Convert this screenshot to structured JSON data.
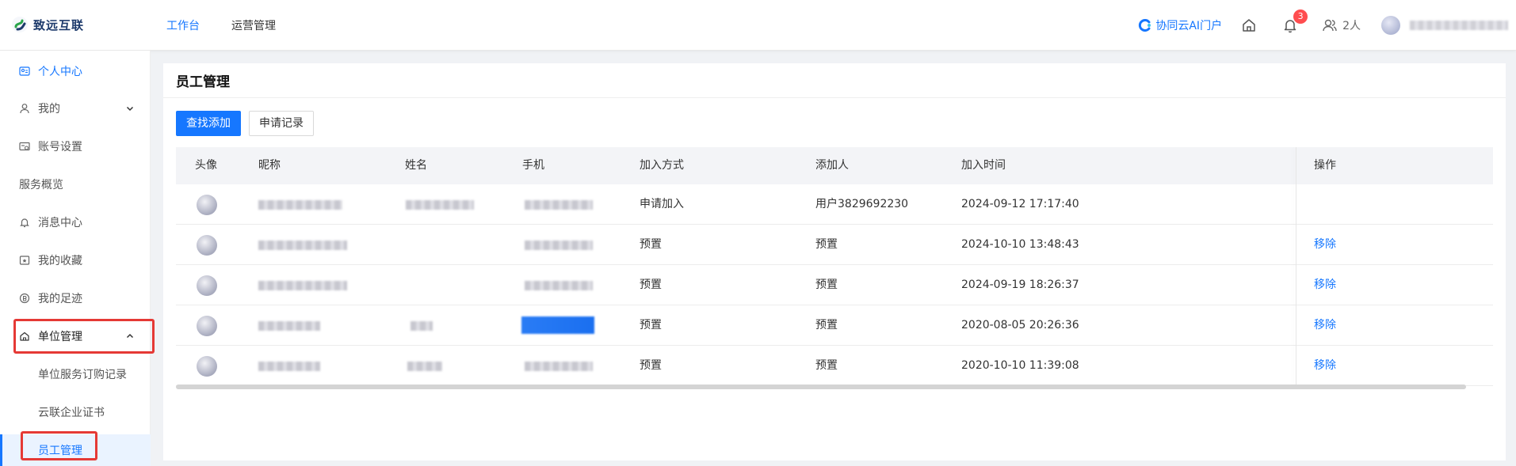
{
  "header": {
    "logo_text": "致远互联",
    "nav": [
      "工作台",
      "运营管理"
    ],
    "ai_portal": "协同云AI门户",
    "notification_count": "3",
    "member_count": "2人"
  },
  "sidebar": {
    "items": [
      {
        "label": "个人中心",
        "icon": "user-card-icon"
      },
      {
        "label": "我的",
        "icon": "user-icon"
      },
      {
        "label": "账号设置",
        "icon": "account-settings-icon"
      },
      {
        "label": "服务概览"
      },
      {
        "label": "消息中心",
        "icon": "bell-icon"
      },
      {
        "label": "我的收藏",
        "icon": "favorites-icon"
      },
      {
        "label": "我的足迹",
        "icon": "footprint-icon"
      },
      {
        "label": "单位管理",
        "icon": "home-icon"
      },
      {
        "label": "单位服务订购记录"
      },
      {
        "label": "云联企业证书"
      },
      {
        "label": "员工管理"
      }
    ]
  },
  "main": {
    "title": "员工管理",
    "buttons": {
      "search_add": "查找添加",
      "apply_records": "申请记录"
    },
    "columns": [
      "头像",
      "昵称",
      "姓名",
      "手机",
      "加入方式",
      "添加人",
      "加入时间",
      "操作"
    ],
    "rows": [
      {
        "join_method": "申请加入",
        "adder": "用户3829692230",
        "join_time": "2024-09-12 17:17:40",
        "action": ""
      },
      {
        "join_method": "预置",
        "adder": "预置",
        "join_time": "2024-10-10 13:48:43",
        "action": "移除"
      },
      {
        "join_method": "预置",
        "adder": "预置",
        "join_time": "2024-09-19 18:26:37",
        "action": "移除"
      },
      {
        "join_method": "预置",
        "adder": "预置",
        "join_time": "2020-08-05 20:26:36",
        "action": "移除"
      },
      {
        "join_method": "预置",
        "adder": "预置",
        "join_time": "2020-10-10 11:39:08",
        "action": "移除"
      }
    ]
  },
  "colors": {
    "accent": "#1677ff",
    "highlight_box": "#e53935",
    "badge": "#ff4d4f"
  }
}
